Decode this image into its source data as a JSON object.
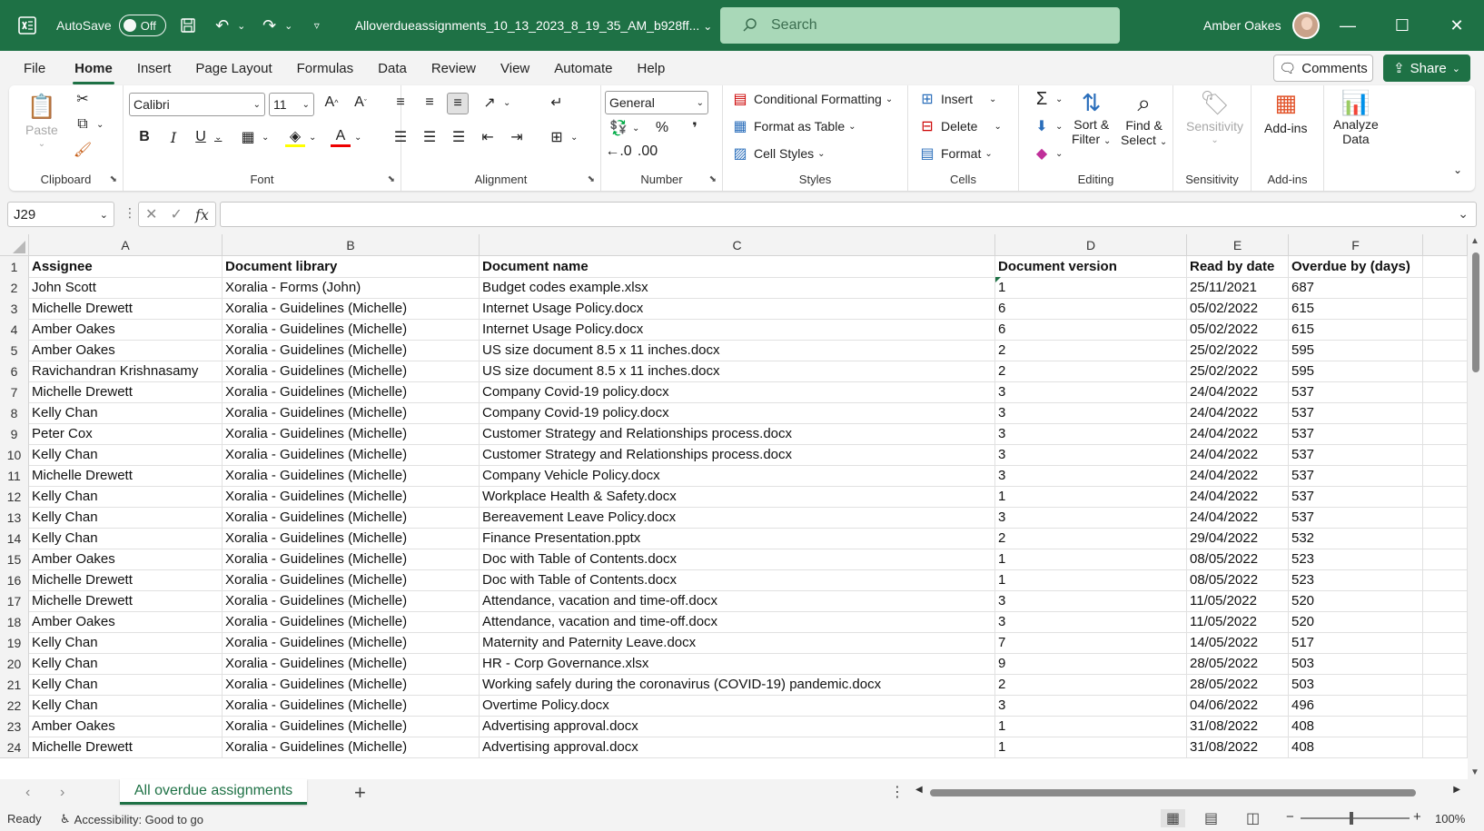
{
  "titlebar": {
    "autosave_label": "AutoSave",
    "autosave_state": "Off",
    "filename": "Alloverdueassignments_10_13_2023_8_19_35_AM_b928ff...",
    "search_placeholder": "Search",
    "user_name": "Amber Oakes"
  },
  "menu": {
    "tabs": [
      "File",
      "Home",
      "Insert",
      "Page Layout",
      "Formulas",
      "Data",
      "Review",
      "View",
      "Automate",
      "Help"
    ],
    "active": "Home",
    "comments_label": "Comments",
    "share_label": "Share"
  },
  "ribbon": {
    "clipboard": {
      "label": "Clipboard",
      "paste": "Paste"
    },
    "font": {
      "label": "Font",
      "name": "Calibri",
      "size": "11"
    },
    "alignment": {
      "label": "Alignment"
    },
    "number": {
      "label": "Number",
      "format": "General"
    },
    "styles": {
      "label": "Styles",
      "conditional": "Conditional Formatting",
      "format_table": "Format as Table",
      "cell_styles": "Cell Styles"
    },
    "cells": {
      "label": "Cells",
      "insert": "Insert",
      "delete": "Delete",
      "format": "Format"
    },
    "editing": {
      "label": "Editing",
      "sort": "Sort &",
      "filter": "Filter",
      "find": "Find &",
      "select": "Select"
    },
    "sensitivity": {
      "label": "Sensitivity",
      "button": "Sensitivity"
    },
    "addins": {
      "label": "Add-ins",
      "button": "Add-ins"
    },
    "analyze": {
      "line1": "Analyze",
      "line2": "Data"
    }
  },
  "formula_bar": {
    "name_box": "J29",
    "formula": ""
  },
  "columns": [
    {
      "letter": "A",
      "width": 213
    },
    {
      "letter": "B",
      "width": 283
    },
    {
      "letter": "C",
      "width": 568
    },
    {
      "letter": "D",
      "width": 211
    },
    {
      "letter": "E",
      "width": 112
    },
    {
      "letter": "F",
      "width": 148
    }
  ],
  "header_row": [
    "Assignee",
    "Document library",
    "Document name",
    "Document version",
    "Read by date",
    "Overdue by (days)"
  ],
  "rows": [
    [
      "John Scott",
      "Xoralia - Forms (John)",
      "Budget codes example.xlsx",
      "1",
      "25/11/2021",
      "687"
    ],
    [
      "Michelle Drewett",
      "Xoralia - Guidelines (Michelle)",
      "Internet Usage Policy.docx",
      "6",
      "05/02/2022",
      "615"
    ],
    [
      "Amber Oakes",
      "Xoralia - Guidelines (Michelle)",
      "Internet Usage Policy.docx",
      "6",
      "05/02/2022",
      "615"
    ],
    [
      "Amber Oakes",
      "Xoralia - Guidelines (Michelle)",
      "US size document 8.5 x 11 inches.docx",
      "2",
      "25/02/2022",
      "595"
    ],
    [
      "Ravichandran Krishnasamy",
      "Xoralia - Guidelines (Michelle)",
      "US size document 8.5 x 11 inches.docx",
      "2",
      "25/02/2022",
      "595"
    ],
    [
      "Michelle Drewett",
      "Xoralia - Guidelines (Michelle)",
      "Company Covid-19 policy.docx",
      "3",
      "24/04/2022",
      "537"
    ],
    [
      "Kelly Chan",
      "Xoralia - Guidelines (Michelle)",
      "Company Covid-19 policy.docx",
      "3",
      "24/04/2022",
      "537"
    ],
    [
      "Peter Cox",
      "Xoralia - Guidelines (Michelle)",
      "Customer Strategy and Relationships process.docx",
      "3",
      "24/04/2022",
      "537"
    ],
    [
      "Kelly Chan",
      "Xoralia - Guidelines (Michelle)",
      "Customer Strategy and Relationships process.docx",
      "3",
      "24/04/2022",
      "537"
    ],
    [
      "Michelle Drewett",
      "Xoralia - Guidelines (Michelle)",
      "Company Vehicle Policy.docx",
      "3",
      "24/04/2022",
      "537"
    ],
    [
      "Kelly Chan",
      "Xoralia - Guidelines (Michelle)",
      "Workplace Health & Safety.docx",
      "1",
      "24/04/2022",
      "537"
    ],
    [
      "Kelly Chan",
      "Xoralia - Guidelines (Michelle)",
      "Bereavement Leave Policy.docx",
      "3",
      "24/04/2022",
      "537"
    ],
    [
      "Kelly Chan",
      "Xoralia - Guidelines (Michelle)",
      "Finance Presentation.pptx",
      "2",
      "29/04/2022",
      "532"
    ],
    [
      "Amber Oakes",
      "Xoralia - Guidelines (Michelle)",
      "Doc with Table of Contents.docx",
      "1",
      "08/05/2022",
      "523"
    ],
    [
      "Michelle Drewett",
      "Xoralia - Guidelines (Michelle)",
      "Doc with Table of Contents.docx",
      "1",
      "08/05/2022",
      "523"
    ],
    [
      "Michelle Drewett",
      "Xoralia - Guidelines (Michelle)",
      "Attendance, vacation and time-off.docx",
      "3",
      "11/05/2022",
      "520"
    ],
    [
      "Amber Oakes",
      "Xoralia - Guidelines (Michelle)",
      "Attendance, vacation and time-off.docx",
      "3",
      "11/05/2022",
      "520"
    ],
    [
      "Kelly Chan",
      "Xoralia - Guidelines (Michelle)",
      "Maternity and Paternity Leave.docx",
      "7",
      "14/05/2022",
      "517"
    ],
    [
      "Kelly Chan",
      "Xoralia - Guidelines (Michelle)",
      "HR - Corp Governance.xlsx",
      "9",
      "28/05/2022",
      "503"
    ],
    [
      "Kelly Chan",
      "Xoralia - Guidelines (Michelle)",
      "Working safely during the coronavirus (COVID-19) pandemic.docx",
      "2",
      "28/05/2022",
      "503"
    ],
    [
      "Kelly Chan",
      "Xoralia - Guidelines (Michelle)",
      "Overtime Policy.docx",
      "3",
      "04/06/2022",
      "496"
    ],
    [
      "Amber Oakes",
      "Xoralia - Guidelines (Michelle)",
      "Advertising approval.docx",
      "1",
      "31/08/2022",
      "408"
    ],
    [
      "Michelle Drewett",
      "Xoralia - Guidelines (Michelle)",
      "Advertising approval.docx",
      "1",
      "31/08/2022",
      "408"
    ]
  ],
  "sheet_tab": "All overdue assignments",
  "status": {
    "ready": "Ready",
    "accessibility": "Accessibility: Good to go",
    "zoom": "100%"
  },
  "colors": {
    "accent": "#1e7145"
  }
}
